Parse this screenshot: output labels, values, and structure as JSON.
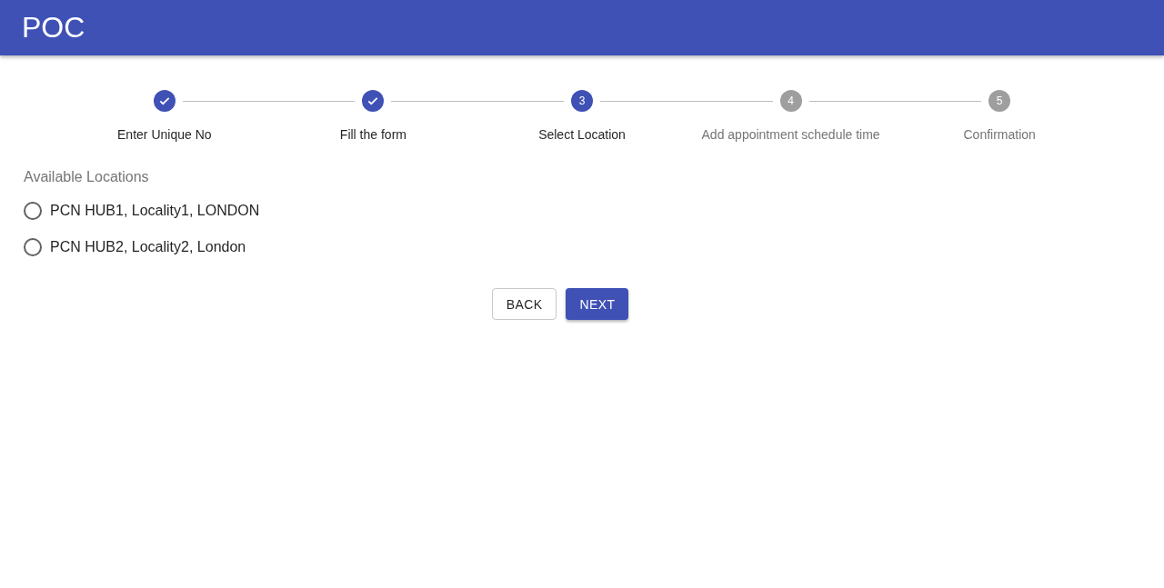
{
  "app_bar": {
    "title": "POC"
  },
  "steps": [
    {
      "label": "Enter Unique No",
      "kind": "done"
    },
    {
      "label": "Fill the form",
      "kind": "done"
    },
    {
      "label": "Select Location",
      "kind": "current",
      "number": "3"
    },
    {
      "label": "Add appointment schedule time",
      "kind": "todo",
      "number": "4"
    },
    {
      "label": "Confirmation",
      "kind": "todo",
      "number": "5"
    }
  ],
  "locations": {
    "legend": "Available Locations",
    "options": [
      {
        "label": "PCN HUB1, Locality1, LONDON",
        "selected": false
      },
      {
        "label": "PCN HUB2, Locality2, London",
        "selected": false
      }
    ]
  },
  "buttons": {
    "back": "BACK",
    "next": "NEXT"
  }
}
